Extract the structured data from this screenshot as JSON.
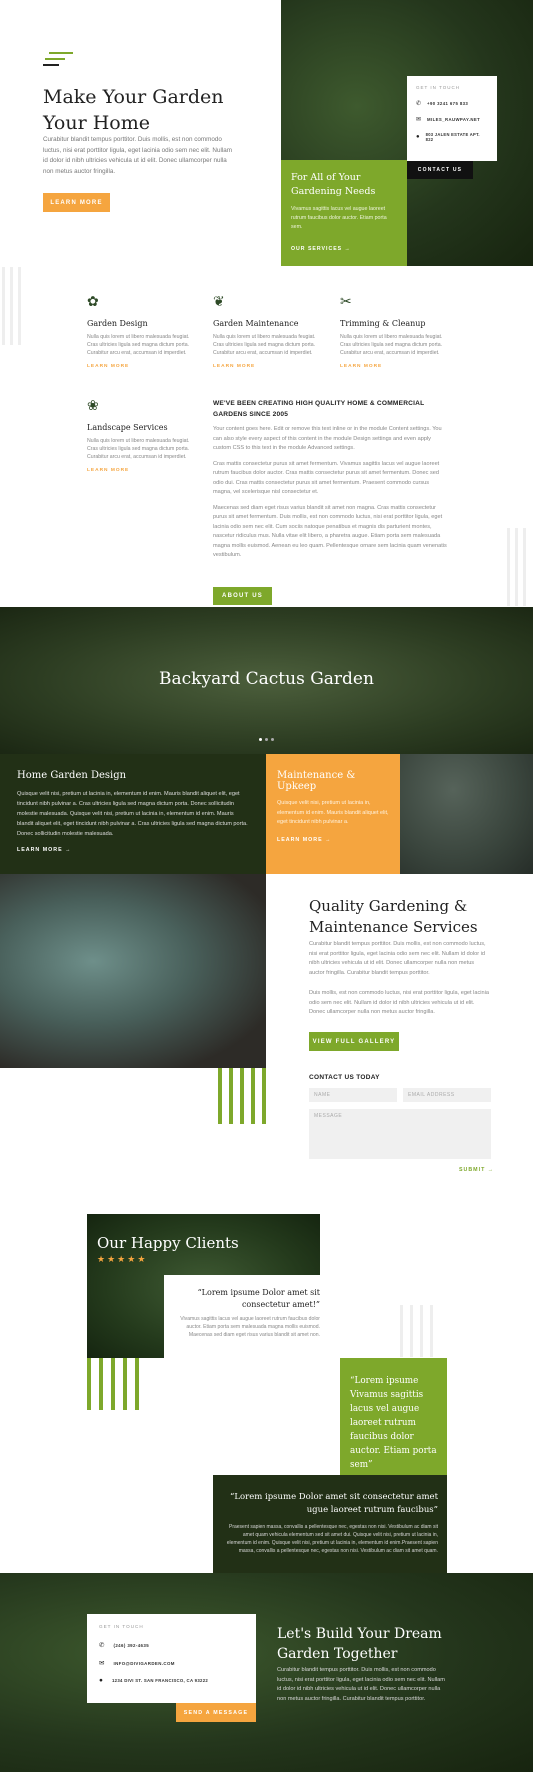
{
  "hero": {
    "title_line1": "Make Your Garden",
    "title_line2": "Your Home",
    "text": "Curabitur blandit tempus porttitor. Duis mollis, est non commodo luctus, nisi erat porttitor ligula, eget lacinia odio sem nec elit. Nullam id dolor id nibh ultricies vehicula ut id elit. Donec ullamcorper nulla non metus auctor fringilla.",
    "button": "LEARN MORE"
  },
  "touch_card": {
    "title": "GET IN TOUCH",
    "phone": "+90 3241 675 833",
    "email": "MILES_RAUWPAY.NET",
    "address": "803 JALEN ESTATE APT. 822",
    "button": "CONTACT US"
  },
  "needs_box": {
    "title": "For All of Your Gardening Needs",
    "text": "Vivamus sagittis lacus vel augue laoreet rutrum faucibus dolor auctor. Etiam porta sem.",
    "link": "OUR SERVICES →"
  },
  "services": [
    {
      "icon": "garden-design-icon",
      "title": "Garden Design",
      "text": "Nulla quis lorem ut libero malesuada feugiat. Cras ultricies ligula sed magna dictum porta. Curabitur arcu erat, accumsan id imperdiet.",
      "link": "LEARN MORE"
    },
    {
      "icon": "garden-maintenance-icon",
      "title": "Garden Maintenance",
      "text": "Nulla quis lorem ut libero malesuada feugiat. Cras ultricies ligula sed magna dictum porta. Curabitur arcu erat, accumsan id imperdiet.",
      "link": "LEARN MORE"
    },
    {
      "icon": "trimming-icon",
      "title": "Trimming & Cleanup",
      "text": "Nulla quis lorem ut libero malesuada feugiat. Cras ultricies ligula sed magna dictum porta. Curabitur arcu erat, accumsan id imperdiet.",
      "link": "LEARN MORE"
    },
    {
      "icon": "landscape-icon",
      "title": "Landscape Services",
      "text": "Nulla quis lorem ut libero malesuada feugiat. Cras ultricies ligula sed magna dictum porta. Curabitur arcu erat, accumsan id imperdiet.",
      "link": "LEARN MORE"
    }
  ],
  "about": {
    "heading": "WE'VE BEEN CREATING HIGH QUALITY HOME & COMMERCIAL GARDENS SINCE 2005",
    "p1": "Your content goes here. Edit or remove this text inline or in the module Content settings. You can also style every aspect of this content in the module Design settings and even apply custom CSS to this text in the module Advanced settings.",
    "p2": "Cras mattis consectetur purus sit amet fermentum. Vivamus sagittis lacus vel augue laoreet rutrum faucibus dolor auctor. Cras mattis consectetur purus sit amet fermentum. Donec sed odio dui. Cras mattis consectetur purus sit amet fermentum. Praesent commodo cursus magna, vel scelerisque nisl consectetur et.",
    "p3": "Maecenas sed diam eget risus varius blandit sit amet non magna. Cras mattis consectetur purus sit amet fermentum. Duis mollis, est non commodo luctus, nisi erat porttitor ligula, eget lacinia odio sem nec elit. Cum sociis natoque penatibus et magnis dis parturient montes, nascetur ridiculus mus. Nulla vitae elit libero, a pharetra augue. Etiam porta sem malesuada magna mollis euismod. Aenean eu leo quam. Pellentesque ornare sem lacinia quam venenatis vestibulum.",
    "button": "ABOUT US"
  },
  "slider": {
    "title": "Backyard Cactus Garden"
  },
  "home_design": {
    "title": "Home Garden Design",
    "text": "Quisque velit nisi, pretium ut lacinia in, elementum id enim. Mauris blandit aliquet elit, eget tincidunt nibh pulvinar a. Cras ultricies ligula sed magna dictum porta. Donec sollicitudin molestie malesuada. Quisque velit nisi, pretium ut lacinia in, elementum id enim. Mauris blandit aliquet elit, eget tincidunt nibh pulvinar a. Cras ultricies ligula sed magna dictum porta. Donec sollicitudin molestie malesuada.",
    "link": "LEARN MORE →"
  },
  "maintenance": {
    "title": "Maintenance & Upkeep",
    "text": "Quisque velit nisi, pretium ut lacinia in, elementum id enim. Mauris blandit aliquet elit, eget tincidunt nibh pulvinar a.",
    "link": "LEARN MORE →"
  },
  "quality": {
    "title_line1": "Quality Gardening &",
    "title_line2": "Maintenance Services",
    "p1": "Curabitur blandit tempus porttitor. Duis mollis, est non commodo luctus, nisi erat porttitor ligula, eget lacinia odio sem nec elit. Nullam id dolor id nibh ultricies vehicula ut id elit. Donec ullamcorper nulla non metus auctor fringilla. Curabitur blandit tempus porttitor.",
    "p2": "Duis mollis, est non commodo luctus, nisi erat porttitor ligula, eget lacinia odio sem nec elit. Nullam id dolor id nibh ultricies vehicula ut id elit. Donec ullamcorper nulla non metus auctor fringilla.",
    "button": "VIEW FULL GALLERY"
  },
  "contact_form": {
    "title": "CONTACT US TODAY",
    "name": "NAME",
    "email": "EMAIL ADDRESS",
    "message": "MESSAGE",
    "submit": "SUBMIT →"
  },
  "clients": {
    "title": "Our Happy Clients",
    "quote1": "“Lorem ipsume Dolor amet sit consectetur amet!”",
    "quote1_text": "Vivamus sagittis lacus vel augue laoreet rutrum faucibus dolor auctor. Etiam porta sem malesuada magna mollis euismod. Maecenas sed diam eget risus varius blandit sit amet non.",
    "quote2": "“Lorem ipsume Vivamus sagittis lacus vel augue laoreet rutrum faucibus dolor auctor. Etiam porta sem”",
    "quote3": "“Lorem ipsume Dolor amet sit consectetur amet ugue laoreet rutrum faucibus”",
    "quote3_text": "Praesent sapien massa, convallis a pellentesque nec, egestas non nisi. Vestibulum ac diam sit amet quam vehicula elementum sed sit amet dui. Quisque velit nisi, pretium ut lacinia in, elementum id enim. Quisque velit nisi, pretium ut lacinia in, elementum id enim.Praesent sapien massa, convallis a pellentesque nec, egestas non nisi. Vestibulum ac diam sit amet quam."
  },
  "footer_card": {
    "title": "GET IN TOUCH",
    "phone": "(246) 392-4635",
    "email": "INFO@DIVIGARDEN.COM",
    "address": "1234 DIVI ST. SAN FRANCISCO, CA 93222",
    "button": "SEND A MESSAGE"
  },
  "build": {
    "title_line1": "Let's Build Your Dream",
    "title_line2": "Garden Together",
    "text": "Curabitur blandit tempus porttitor. Duis mollis, est non commodo luctus, nisi erat porttitor ligula, eget lacinia odio sem nec elit. Nullam id dolor id nibh ultricies vehicula ut id elit. Donec ullamcorper nulla non metus auctor fringilla. Curabitur blandit tempus porttitor."
  }
}
